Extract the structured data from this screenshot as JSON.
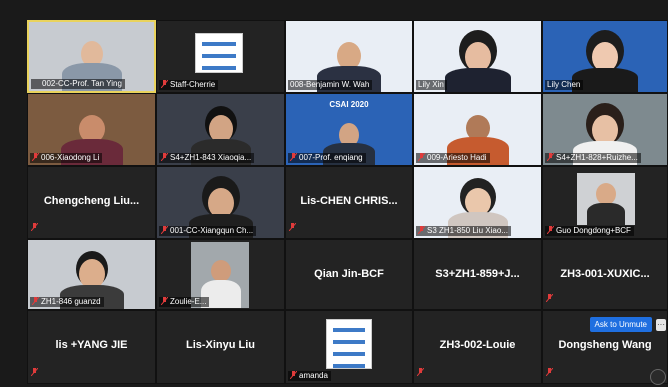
{
  "tiles": [
    {
      "name": "002-CC-Prof. Tan Ying",
      "type": "video",
      "style": "wall",
      "active": true
    },
    {
      "name": "Staff-Cherrie",
      "type": "poster"
    },
    {
      "name": "008-Benjamin W. Wah",
      "type": "video",
      "style": "light"
    },
    {
      "name": "Lily Xin",
      "type": "video",
      "style": "light"
    },
    {
      "name": "Lily Chen",
      "type": "video",
      "style": "blue"
    },
    {
      "name": "006-Xiaodong Li",
      "type": "video",
      "style": "wood"
    },
    {
      "name": "S4+ZH1-843 Xiaoqia...",
      "type": "video",
      "style": "dark"
    },
    {
      "name": "007-Prof. enqiang",
      "type": "video",
      "style": "blue",
      "banner": "CSAI 2020"
    },
    {
      "name": "009-Ariesto Hadi",
      "type": "video",
      "style": "light"
    },
    {
      "name": "S4+ZH1-828+Ruizhe...",
      "type": "video",
      "style": "room"
    },
    {
      "name": "Chengcheng  Liu...",
      "type": "name"
    },
    {
      "name": "001-CC-Xiangqun Ch...",
      "type": "video",
      "style": "dark"
    },
    {
      "name": "Lis-CHEN  CHRIS...",
      "type": "name"
    },
    {
      "name": "S3 ZH1-850 Liu Xiao...",
      "type": "video",
      "style": "light"
    },
    {
      "name": "Guo Dongdong+BCF",
      "type": "video",
      "style": "dark"
    },
    {
      "name": "ZH1-846 guanzd",
      "type": "video",
      "style": "wall"
    },
    {
      "name": "Zoulie-E...",
      "type": "video",
      "style": "room"
    },
    {
      "name": "Qian Jin-BCF",
      "type": "name"
    },
    {
      "name": "S3+ZH1-859+J...",
      "type": "name"
    },
    {
      "name": "ZH3-001-XUXIC...",
      "type": "name"
    },
    {
      "name": "lis +YANG JIE",
      "type": "name"
    },
    {
      "name": "Lis-Xinyu Liu",
      "type": "name"
    },
    {
      "name": "amanda",
      "type": "poster"
    },
    {
      "name": "ZH3-002-Louie",
      "type": "name"
    },
    {
      "name": "Dongsheng Wang",
      "type": "name"
    }
  ],
  "ask_to_unmute": "Ask to Unmute",
  "more_glyph": "···"
}
